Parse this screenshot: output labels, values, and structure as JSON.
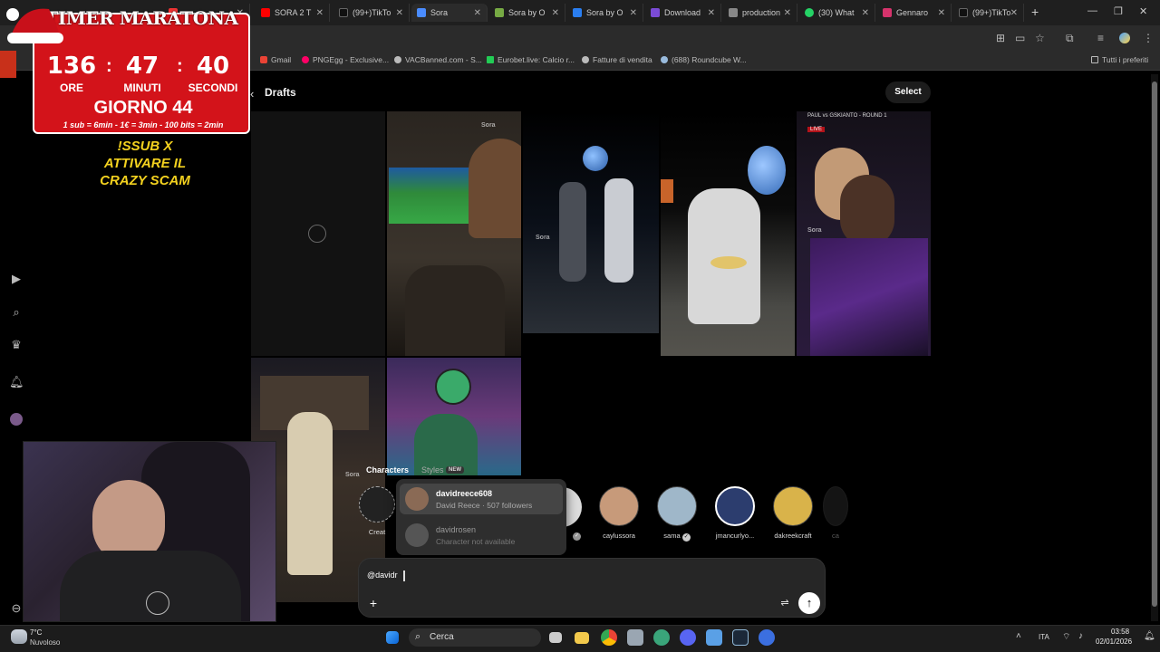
{
  "browser": {
    "tabs": [
      {
        "label": "",
        "color": "#e33"
      },
      {
        "label": "SORA 2 T",
        "color": "#f00"
      },
      {
        "label": "(99+)TikTo",
        "color": "#111"
      },
      {
        "label": "Sora",
        "color": "#4a8cff"
      },
      {
        "label": "Sora by O",
        "color": "#7a4"
      },
      {
        "label": "Sora by O",
        "color": "#2a7ef0"
      },
      {
        "label": "Download",
        "color": "#7b4bd6"
      },
      {
        "label": "production",
        "color": "#888"
      },
      {
        "label": "(30) What",
        "color": "#25d366"
      },
      {
        "label": "Gennaro",
        "color": "#d6336c"
      },
      {
        "label": "(99+)TikTo",
        "color": "#111"
      }
    ],
    "bookmarks": [
      {
        "label": "Gmail",
        "color": "#ea4335"
      },
      {
        "label": "PNGEgg - Exclusive...",
        "color": "#f06"
      },
      {
        "label": "VACBanned.com - S...",
        "color": "#bbb"
      },
      {
        "label": "Eurobet.live: Calcio r...",
        "color": "#2c5"
      },
      {
        "label": "Fatture di vendita",
        "color": "#bbb"
      },
      {
        "label": "(688) Roundcube W...",
        "color": "#9bd"
      }
    ],
    "bookmarks_right": "Tutti i preferiti"
  },
  "timer": {
    "title": "TIMER MARATONA",
    "hours": "136",
    "minutes": "47",
    "seconds": "40",
    "hours_label": "ORE",
    "minutes_label": "MINUTI",
    "seconds_label": "SECONDI",
    "day": "GIORNO 44",
    "note": "1 sub = 6min - 1€ = 3min - 100 bits = 2min"
  },
  "promo": {
    "line1": "!SSUB X",
    "line2": "ATTIVARE IL",
    "line3": "CRAZY SCAM"
  },
  "page": {
    "back_icon": "‹",
    "title": "Drafts",
    "select_label": "Select"
  },
  "thumbs": {
    "wm": "Sora",
    "news_line1": "PAUL vs GSKIANTO - ROUND 1",
    "news_line2": "LIVE"
  },
  "characters": {
    "tab_characters": "Characters",
    "tab_styles": "Styles",
    "new_badge": "NEW",
    "create_label": "Creat",
    "items": [
      {
        "name": "caylussora",
        "color": "#c79a7a"
      },
      {
        "name": "sama",
        "color": "#9fb7c9"
      },
      {
        "name": "jmancurlyo...",
        "color": "#2c3d6e"
      },
      {
        "name": "dakreekcraft",
        "color": "#d9b34a"
      },
      {
        "name": "ca",
        "color": "#333"
      }
    ]
  },
  "suggestions": [
    {
      "name": "davidreece608",
      "sub": "David Reece · 507 followers"
    },
    {
      "name": "davidrosen",
      "sub": "Character not available"
    }
  ],
  "composer": {
    "value": "@davidr",
    "plus": "+",
    "settings_icon": "⇌",
    "send_icon": "↑"
  },
  "taskbar": {
    "temp": "7°C",
    "weather": "Nuvoloso",
    "search": "Cerca",
    "lang": "ITA",
    "time": "03:58",
    "date": "02/01/2026"
  }
}
